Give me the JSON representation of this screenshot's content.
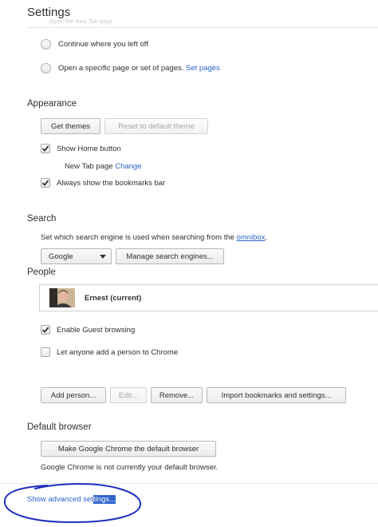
{
  "page_title": "Settings",
  "ghost_text": "Open the New Tab page",
  "startup": {
    "options": [
      {
        "label": "Continue where you left off"
      },
      {
        "label": "Open a specific page or set of pages.",
        "link": "Set pages"
      }
    ]
  },
  "appearance": {
    "title": "Appearance",
    "get_themes": "Get themes",
    "reset_theme": "Reset to default theme",
    "show_home": "Show Home button",
    "new_tab_label": "New Tab page",
    "change_link": "Change",
    "show_bookmarks": "Always show the bookmarks bar"
  },
  "search": {
    "title": "Search",
    "description": "Set which search engine is used when searching from the",
    "omnibox_link": "omnibox",
    "description_end": ".",
    "engine": "Google",
    "manage": "Manage search engines..."
  },
  "people": {
    "title": "People",
    "profile_name": "Ernest (current)",
    "guest": "Enable Guest browsing",
    "anyone": "Let anyone add a person to Chrome",
    "add": "Add person...",
    "edit": "Edit...",
    "remove": "Remove...",
    "import": "Import bookmarks and settings..."
  },
  "default_browser": {
    "title": "Default browser",
    "make_default": "Make Google Chrome the default browser",
    "status": "Google Chrome is not currently your default browser."
  },
  "advanced": {
    "link_start": "Show advanced set",
    "link_selected": "tings..."
  },
  "colors": {
    "link": "#2a62c6",
    "annotation_circle": "#1f2fbf",
    "selection": "#3366cc"
  }
}
